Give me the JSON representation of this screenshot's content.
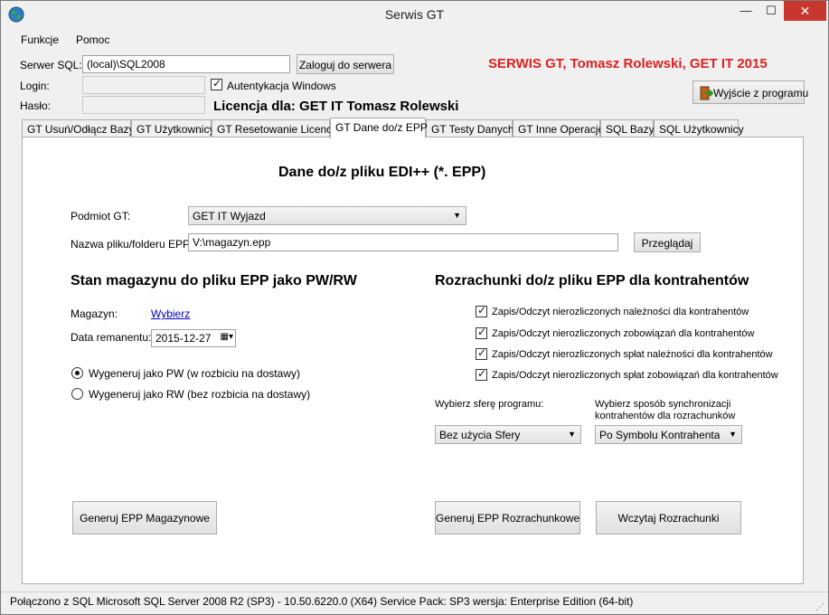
{
  "window": {
    "title": "Serwis GT",
    "min": "—",
    "max": "☐",
    "close": "✕"
  },
  "menu": {
    "funkcje": "Funkcje",
    "pomoc": "Pomoc"
  },
  "server": {
    "label": "Serwer SQL:",
    "value": "(local)\\SQL2008",
    "login_button": "Zaloguj do serwera",
    "login_label": "Login:",
    "password_label": "Hasło:",
    "windows_auth": "Autentykacja Windows"
  },
  "brand": "SERWIS GT, Tomasz Rolewski, GET IT 2015",
  "license": "Licencja dla: GET IT Tomasz Rolewski",
  "exit_button": "Wyjście z programu",
  "tabs": [
    "GT Usuń/Odłącz Bazy",
    "GT Użytkownicy",
    "GT Resetowanie Licencji",
    "GT Dane do/z EPP",
    "GT Testy Danych",
    "GT Inne Operacje",
    "SQL Bazy",
    "SQL Użytkownicy"
  ],
  "panel": {
    "heading": "Dane do/z pliku EDI++ (*. EPP)",
    "subject_label": "Podmiot GT:",
    "subject_value": "GET IT Wyjazd",
    "file_label": "Nazwa pliku/folderu EPP:",
    "file_value": "V:\\magazyn.epp",
    "browse_button": "Przeglądaj",
    "stock": {
      "heading": "Stan magazynu do pliku EPP jako PW/RW",
      "warehouse_label": "Magazyn:",
      "warehouse_link": "Wybierz",
      "date_label": "Data remanentu:",
      "date_value": "2015-12-27",
      "radio_pw": "Wygeneruj jako PW (w rozbiciu na dostawy)",
      "radio_rw": "Wygeneruj jako RW (bez rozbicia na dostawy)",
      "generate_button": "Generuj EPP Magazynowe"
    },
    "settlements": {
      "heading": "Rozrachunki do/z pliku EPP dla kontrahentów",
      "checks": [
        "Zapis/Odczyt nierozliczonych należności dla kontrahentów",
        "Zapis/Odczyt nierozliczonych zobowiązań dla kontrahentów",
        "Zapis/Odczyt nierozliczonych spłat należności dla kontrahentów",
        "Zapis/Odczyt nierozliczonych spłat zobowiązań dla kontrahentów"
      ],
      "sphere_label": "Wybierz sferę programu:",
      "sphere_value": "Bez użycia Sfery",
      "sync_label_1": "Wybierz sposób synchronizacji",
      "sync_label_2": "kontrahentów dla rozrachunków",
      "sync_value": "Po Symbolu Kontrahenta",
      "generate_button": "Generuj EPP Rozrachunkowe",
      "load_button": "Wczytaj Rozrachunki"
    }
  },
  "status": "Połączono z SQL  Microsoft SQL Server 2008 R2 (SP3) - 10.50.6220.0 (X64)  Service Pack: SP3  wersja: Enterprise Edition (64-bit)",
  "colors": {
    "brand": "#e02020",
    "close": "#c7372f",
    "link": "#0000cc"
  }
}
